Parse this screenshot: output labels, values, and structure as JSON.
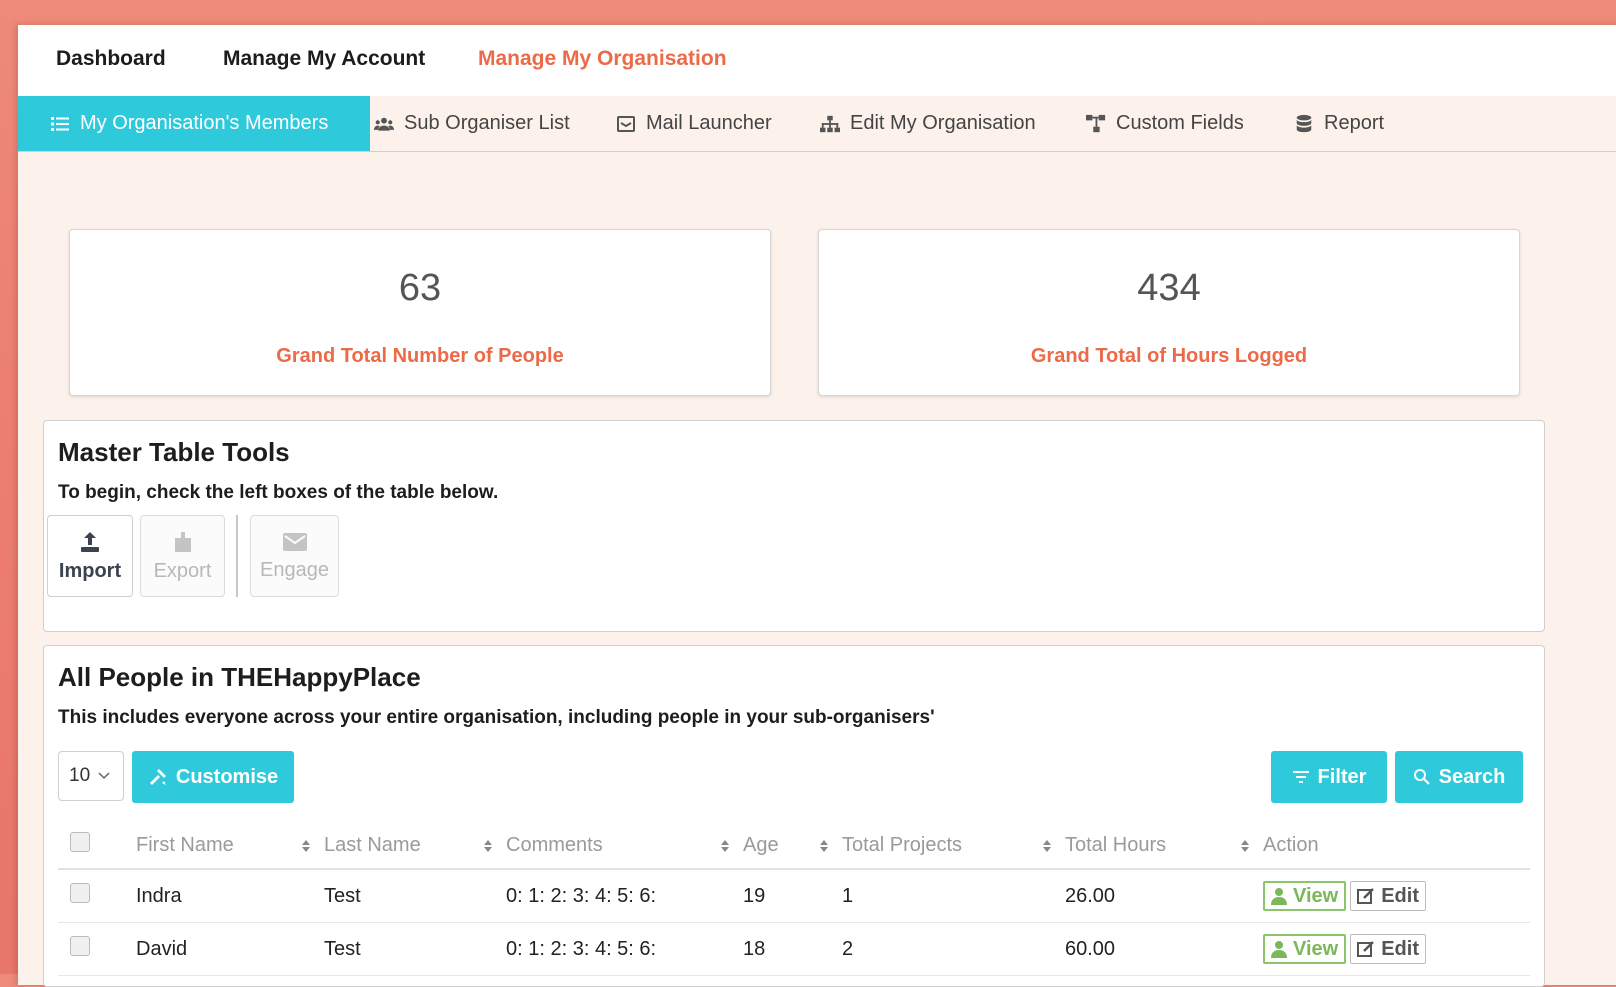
{
  "topnav": {
    "items": [
      {
        "label": "Dashboard"
      },
      {
        "label": "Manage My Account"
      },
      {
        "label": "Manage My Organisation",
        "active": true
      }
    ]
  },
  "subnav": {
    "tabs": [
      {
        "label": "My Organisation's Members",
        "icon": "list-icon",
        "active": true
      },
      {
        "label": "Sub Organiser List",
        "icon": "users-icon"
      },
      {
        "label": "Mail Launcher",
        "icon": "mail-icon"
      },
      {
        "label": "Edit My Organisation",
        "icon": "sitemap-icon"
      },
      {
        "label": "Custom Fields",
        "icon": "custom-fields-icon"
      },
      {
        "label": "Report",
        "icon": "database-icon"
      }
    ]
  },
  "stats": [
    {
      "value": "63",
      "label": "Grand Total Number of People"
    },
    {
      "value": "434",
      "label": "Grand Total of Hours Logged"
    }
  ],
  "tools": {
    "title": "Master Table Tools",
    "description": "To begin, check the left boxes of the table below.",
    "buttons": [
      {
        "label": "Import",
        "icon": "upload-icon",
        "enabled": true
      },
      {
        "label": "Export",
        "icon": "export-icon",
        "enabled": false
      },
      {
        "label": "Engage",
        "icon": "envelope-icon",
        "enabled": false
      }
    ]
  },
  "people": {
    "title": "All People in THEHappyPlace",
    "description": "This includes everyone across your entire organisation, including people in your sub-organisers'",
    "page_size": "10",
    "customise_label": "Customise",
    "filter_label": "Filter",
    "search_label": "Search",
    "columns": [
      "First Name",
      "Last Name",
      "Comments",
      "Age",
      "Total Projects",
      "Total Hours",
      "Action"
    ],
    "rows": [
      {
        "first": "Indra",
        "last": "Test",
        "comments": "0: 1: 2: 3: 4: 5: 6:",
        "age": "19",
        "projects": "1",
        "hours": "26.00"
      },
      {
        "first": "David",
        "last": "Test",
        "comments": "0: 1: 2: 3: 4: 5: 6:",
        "age": "18",
        "projects": "2",
        "hours": "60.00"
      }
    ],
    "view_label": "View",
    "edit_label": "Edit"
  },
  "colors": {
    "accent": "#2fc9dc",
    "brand_orange": "#ec6a48",
    "view_green": "#7ab85a"
  }
}
